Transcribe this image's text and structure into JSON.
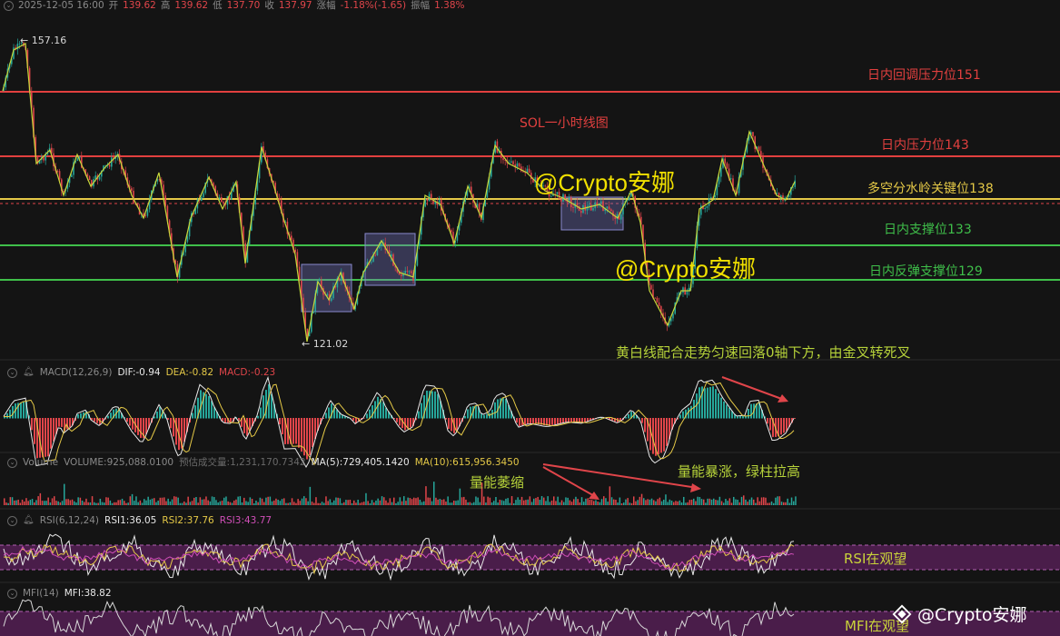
{
  "header": {
    "datetime": "2025-12-05 16:00",
    "open_label": "开",
    "open": "139.62",
    "high_label": "高",
    "high": "139.62",
    "low_label": "低",
    "low": "137.70",
    "close_label": "收",
    "close": "137.97",
    "change_label": "涨幅",
    "change": "-1.18%(-1.65)",
    "amplitude_label": "振幅",
    "amplitude": "1.38%"
  },
  "main_chart": {
    "title": "SOL一小时线图",
    "high_marker": "157.16",
    "low_marker": "121.02",
    "watermark_1": "@Crypto安娜",
    "watermark_2": "@Crypto安娜",
    "levels": [
      {
        "label": "日内回调压力位151",
        "color": "#e2403f"
      },
      {
        "label": "日内压力位143",
        "color": "#e2403f"
      },
      {
        "label": "多空分水岭关键位138",
        "color": "#e5c947"
      },
      {
        "label": "日内支撑位133",
        "color": "#3fbf4a"
      },
      {
        "label": "日内反弹支撑位129",
        "color": "#3fbf4a"
      }
    ]
  },
  "macd": {
    "name": "MACD(12,26,9)",
    "dif": "DIF:-0.94",
    "dea": "DEA:-0.82",
    "macd": "MACD:-0.23",
    "note": "黄白线配合走势匀速回落0轴下方，由金叉转死叉"
  },
  "volume": {
    "name": "Volume",
    "volume": "VOLUME:925,088.0100",
    "estimate": "预估成交量:1,231,170.7342",
    "ma5": "MA(5):729,405.1420",
    "ma10": "MA(10):615,956.3450",
    "note_shrink": "量能萎缩",
    "note_surge": "量能暴涨，绿柱拉高"
  },
  "rsi": {
    "name": "RSI(6,12,24)",
    "rsi1": "RSI1:36.05",
    "rsi2": "RSI2:37.76",
    "rsi3": "RSI3:43.77",
    "note": "RSI在观望"
  },
  "mfi": {
    "name": "MFI(14)",
    "mfi": "MFI:38.82",
    "note": "MFI在观望"
  },
  "footer_watermark": "@Crypto安娜",
  "colors": {
    "up": "#26a69a",
    "down": "#e0454a",
    "yellow": "#e5c947",
    "green": "#3fbf4a",
    "red": "#e2403f",
    "band": "#4a1d4a"
  }
}
